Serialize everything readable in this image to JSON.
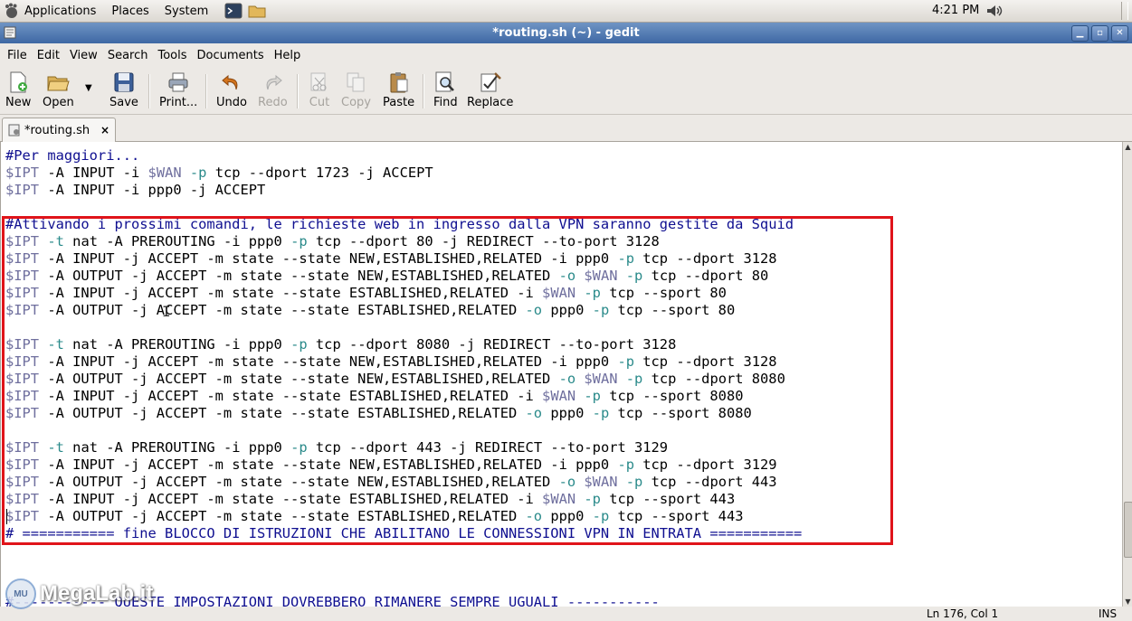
{
  "panel": {
    "menus": [
      "Applications",
      "Places",
      "System"
    ],
    "clock": "4:21 PM"
  },
  "window": {
    "title": "*routing.sh (~) - gedit"
  },
  "menubar": {
    "items": [
      {
        "label": "File"
      },
      {
        "label": "Edit"
      },
      {
        "label": "View"
      },
      {
        "label": "Search"
      },
      {
        "label": "Tools"
      },
      {
        "label": "Documents"
      },
      {
        "label": "Help"
      }
    ]
  },
  "toolbar": {
    "new": "New",
    "open": "Open",
    "save": "Save",
    "print": "Print...",
    "undo": "Undo",
    "redo": "Redo",
    "cut": "Cut",
    "copy": "Copy",
    "paste": "Paste",
    "find": "Find",
    "replace": "Replace"
  },
  "tab": {
    "label": "*routing.sh",
    "close": "×"
  },
  "editor": {
    "lines": [
      [
        {
          "t": "#Per maggiori...",
          "c": "c"
        }
      ],
      [
        {
          "t": "$IPT",
          "c": "v"
        },
        {
          "t": " -A INPUT -i "
        },
        {
          "t": "$WAN",
          "c": "v"
        },
        {
          "t": " "
        },
        {
          "t": "-p",
          "c": "o"
        },
        {
          "t": " tcp --dport 1723 -j ACCEPT"
        }
      ],
      [
        {
          "t": "$IPT",
          "c": "v"
        },
        {
          "t": " -A INPUT -i ppp0 -j ACCEPT"
        }
      ],
      [],
      [
        {
          "t": "#Attivando i prossimi comandi, le richieste web in ingresso dalla VPN saranno gestite da Squid",
          "c": "c"
        }
      ],
      [
        {
          "t": "$IPT",
          "c": "v"
        },
        {
          "t": " "
        },
        {
          "t": "-t",
          "c": "o"
        },
        {
          "t": " nat -A PREROUTING -i ppp0 "
        },
        {
          "t": "-p",
          "c": "o"
        },
        {
          "t": " tcp --dport 80 -j REDIRECT --to-port 3128"
        }
      ],
      [
        {
          "t": "$IPT",
          "c": "v"
        },
        {
          "t": " -A INPUT -j ACCEPT -m state --state NEW,ESTABLISHED,RELATED -i ppp0 "
        },
        {
          "t": "-p",
          "c": "o"
        },
        {
          "t": " tcp --dport 3128"
        }
      ],
      [
        {
          "t": "$IPT",
          "c": "v"
        },
        {
          "t": " -A OUTPUT -j ACCEPT -m state --state NEW,ESTABLISHED,RELATED "
        },
        {
          "t": "-o",
          "c": "o"
        },
        {
          "t": " "
        },
        {
          "t": "$WAN",
          "c": "v"
        },
        {
          "t": " "
        },
        {
          "t": "-p",
          "c": "o"
        },
        {
          "t": " tcp --dport 80"
        }
      ],
      [
        {
          "t": "$IPT",
          "c": "v"
        },
        {
          "t": " -A INPUT -j ACCEPT -m state --state ESTABLISHED,RELATED -i "
        },
        {
          "t": "$WAN",
          "c": "v"
        },
        {
          "t": " "
        },
        {
          "t": "-p",
          "c": "o"
        },
        {
          "t": " tcp --sport 80"
        }
      ],
      [
        {
          "t": "$IPT",
          "c": "v"
        },
        {
          "t": " -A OUTPUT -j ACCEPT -m state --state ESTABLISHED,RELATED "
        },
        {
          "t": "-o",
          "c": "o"
        },
        {
          "t": " ppp0 "
        },
        {
          "t": "-p",
          "c": "o"
        },
        {
          "t": " tcp --sport 80"
        }
      ],
      [],
      [
        {
          "t": "$IPT",
          "c": "v"
        },
        {
          "t": " "
        },
        {
          "t": "-t",
          "c": "o"
        },
        {
          "t": " nat -A PREROUTING -i ppp0 "
        },
        {
          "t": "-p",
          "c": "o"
        },
        {
          "t": " tcp --dport 8080 -j REDIRECT --to-port 3128"
        }
      ],
      [
        {
          "t": "$IPT",
          "c": "v"
        },
        {
          "t": " -A INPUT -j ACCEPT -m state --state NEW,ESTABLISHED,RELATED -i ppp0 "
        },
        {
          "t": "-p",
          "c": "o"
        },
        {
          "t": " tcp --dport 3128"
        }
      ],
      [
        {
          "t": "$IPT",
          "c": "v"
        },
        {
          "t": " -A OUTPUT -j ACCEPT -m state --state NEW,ESTABLISHED,RELATED "
        },
        {
          "t": "-o",
          "c": "o"
        },
        {
          "t": " "
        },
        {
          "t": "$WAN",
          "c": "v"
        },
        {
          "t": " "
        },
        {
          "t": "-p",
          "c": "o"
        },
        {
          "t": " tcp --dport 8080"
        }
      ],
      [
        {
          "t": "$IPT",
          "c": "v"
        },
        {
          "t": " -A INPUT -j ACCEPT -m state --state ESTABLISHED,RELATED -i "
        },
        {
          "t": "$WAN",
          "c": "v"
        },
        {
          "t": " "
        },
        {
          "t": "-p",
          "c": "o"
        },
        {
          "t": " tcp --sport 8080"
        }
      ],
      [
        {
          "t": "$IPT",
          "c": "v"
        },
        {
          "t": " -A OUTPUT -j ACCEPT -m state --state ESTABLISHED,RELATED "
        },
        {
          "t": "-o",
          "c": "o"
        },
        {
          "t": " ppp0 "
        },
        {
          "t": "-p",
          "c": "o"
        },
        {
          "t": " tcp --sport 8080"
        }
      ],
      [],
      [
        {
          "t": "$IPT",
          "c": "v"
        },
        {
          "t": " "
        },
        {
          "t": "-t",
          "c": "o"
        },
        {
          "t": " nat -A PREROUTING -i ppp0 "
        },
        {
          "t": "-p",
          "c": "o"
        },
        {
          "t": " tcp --dport 443 -j REDIRECT --to-port 3129"
        }
      ],
      [
        {
          "t": "$IPT",
          "c": "v"
        },
        {
          "t": " -A INPUT -j ACCEPT -m state --state NEW,ESTABLISHED,RELATED -i ppp0 "
        },
        {
          "t": "-p",
          "c": "o"
        },
        {
          "t": " tcp --dport 3129"
        }
      ],
      [
        {
          "t": "$IPT",
          "c": "v"
        },
        {
          "t": " -A OUTPUT -j ACCEPT -m state --state NEW,ESTABLISHED,RELATED "
        },
        {
          "t": "-o",
          "c": "o"
        },
        {
          "t": " "
        },
        {
          "t": "$WAN",
          "c": "v"
        },
        {
          "t": " "
        },
        {
          "t": "-p",
          "c": "o"
        },
        {
          "t": " tcp --dport 443"
        }
      ],
      [
        {
          "t": "$IPT",
          "c": "v"
        },
        {
          "t": " -A INPUT -j ACCEPT -m state --state ESTABLISHED,RELATED -i "
        },
        {
          "t": "$WAN",
          "c": "v"
        },
        {
          "t": " "
        },
        {
          "t": "-p",
          "c": "o"
        },
        {
          "t": " tcp --sport 443"
        }
      ],
      [
        {
          "t": "$IPT",
          "c": "v"
        },
        {
          "t": " -A OUTPUT -j ACCEPT -m state --state ESTABLISHED,RELATED "
        },
        {
          "t": "-o",
          "c": "o"
        },
        {
          "t": " ppp0 "
        },
        {
          "t": "-p",
          "c": "o"
        },
        {
          "t": " tcp --sport 443"
        }
      ],
      [
        {
          "t": "# =========== fine BLOCCO DI ISTRUZIONI CHE ABILITANO LE CONNESSIONI VPN IN ENTRATA ===========",
          "c": "c"
        }
      ],
      [],
      [],
      [],
      [
        {
          "t": "#----------- QUESTE IMPOSTAZIONI DOVREBBERO RIMANERE SEMPRE UGUALI -----------",
          "c": "c"
        }
      ]
    ]
  },
  "status": {
    "position": "Ln 176, Col 1",
    "mode": "INS"
  },
  "watermark": {
    "badge": "MU",
    "text": "MegaLab.it"
  },
  "colors": {
    "comment": "#0f0f90",
    "variable": "#6f6f9e",
    "option": "#2a8a8a",
    "highlight_box": "#e0141a",
    "titlebar": "#3e68a4"
  }
}
